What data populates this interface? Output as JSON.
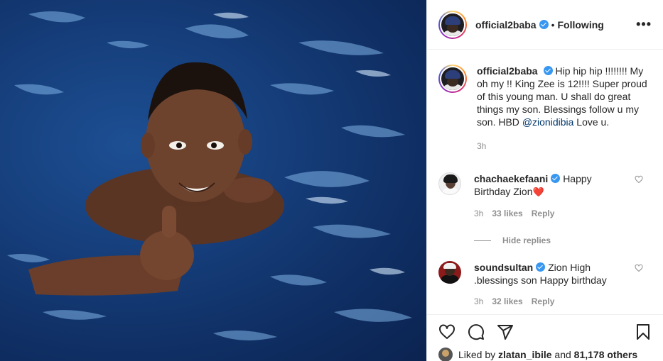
{
  "post": {
    "username": "official2baba",
    "follow_dot": "•",
    "follow_status": "Following",
    "more_icon_label": "•••"
  },
  "caption": {
    "username": "official2baba",
    "text_part1": "Hip hip hip !!!!!!!! My oh my !! King Zee is 12!!!! Super proud of this young man. U shall do great things my son. Blessings follow u my son. HBD ",
    "mention": "@zionidibia",
    "text_part2": " Love u.",
    "time": "3h"
  },
  "comments": [
    {
      "username": "chachaekefaani",
      "text": "Happy Birthday Zion",
      "emoji": "❤️",
      "time": "3h",
      "likes": "33 likes",
      "reply": "Reply"
    },
    {
      "username": "soundsultan",
      "text": "Zion High .blessings son Happy birthday",
      "time": "3h",
      "likes": "32 likes",
      "reply": "Reply"
    }
  ],
  "hide_replies": "Hide replies",
  "liked_by": {
    "prefix": "Liked by ",
    "user": "zlatan_ibile",
    "middle": " and ",
    "count": "81,178 others"
  },
  "icons": [
    "heart-icon",
    "comment-icon",
    "share-icon",
    "bookmark-icon"
  ],
  "colors": {
    "verified": "#3897f0",
    "link": "#00376b",
    "heart": "#ed4956",
    "muted": "#8e8e8e"
  }
}
